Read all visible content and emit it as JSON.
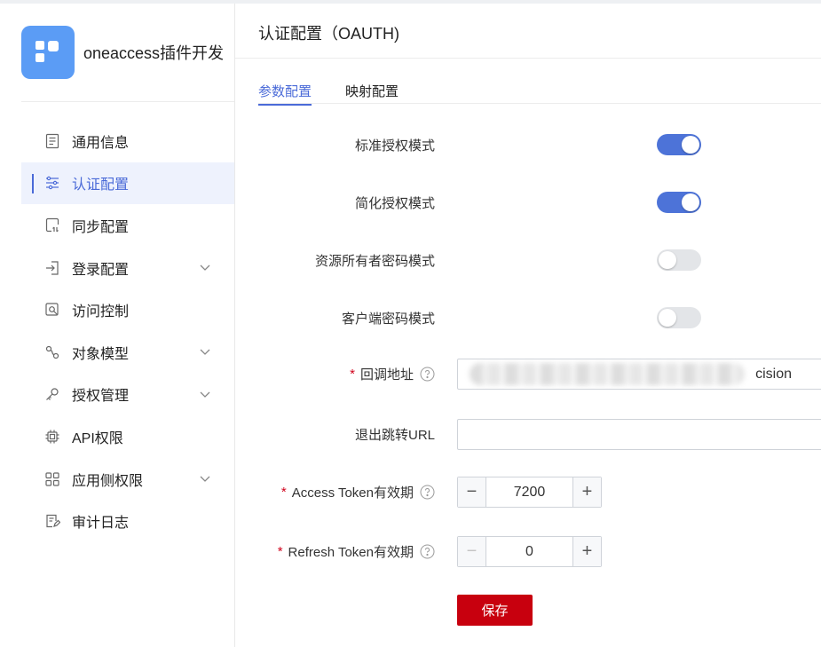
{
  "app": {
    "name": "oneaccess插件开发"
  },
  "sidebar": {
    "items": [
      {
        "label": "通用信息",
        "icon": "document-list-icon"
      },
      {
        "label": "认证配置",
        "icon": "sliders-icon",
        "active": true
      },
      {
        "label": "同步配置",
        "icon": "sync-icon"
      },
      {
        "label": "登录配置",
        "icon": "login-icon",
        "expandable": true
      },
      {
        "label": "访问控制",
        "icon": "access-control-icon"
      },
      {
        "label": "对象模型",
        "icon": "object-model-icon",
        "expandable": true
      },
      {
        "label": "授权管理",
        "icon": "key-icon",
        "expandable": true
      },
      {
        "label": "API权限",
        "icon": "chip-icon"
      },
      {
        "label": "应用侧权限",
        "icon": "grid-icon",
        "expandable": true
      },
      {
        "label": "审计日志",
        "icon": "audit-log-icon"
      }
    ]
  },
  "main": {
    "title": "认证配置（OAUTH)",
    "tabs": [
      {
        "label": "参数配置",
        "active": true
      },
      {
        "label": "映射配置",
        "active": false
      }
    ],
    "form": {
      "standard_auth": {
        "label": "标准授权模式",
        "on": true
      },
      "simplified_auth": {
        "label": "简化授权模式",
        "on": true
      },
      "resource_owner": {
        "label": "资源所有者密码模式",
        "on": false
      },
      "client_password": {
        "label": "客户端密码模式",
        "on": false
      },
      "callback": {
        "label": "回调地址",
        "value": "cision",
        "required": true
      },
      "logout_url": {
        "label": "退出跳转URL",
        "value": ""
      },
      "access_token": {
        "label": "Access Token有效期",
        "value": "7200",
        "required": true
      },
      "refresh_token": {
        "label": "Refresh Token有效期",
        "value": "0",
        "required": true
      }
    },
    "save_label": "保存"
  },
  "colors": {
    "accent": "#4a6ad8",
    "switch_on": "#4d73d8",
    "save": "#c8000e",
    "required": "#d0021b"
  }
}
